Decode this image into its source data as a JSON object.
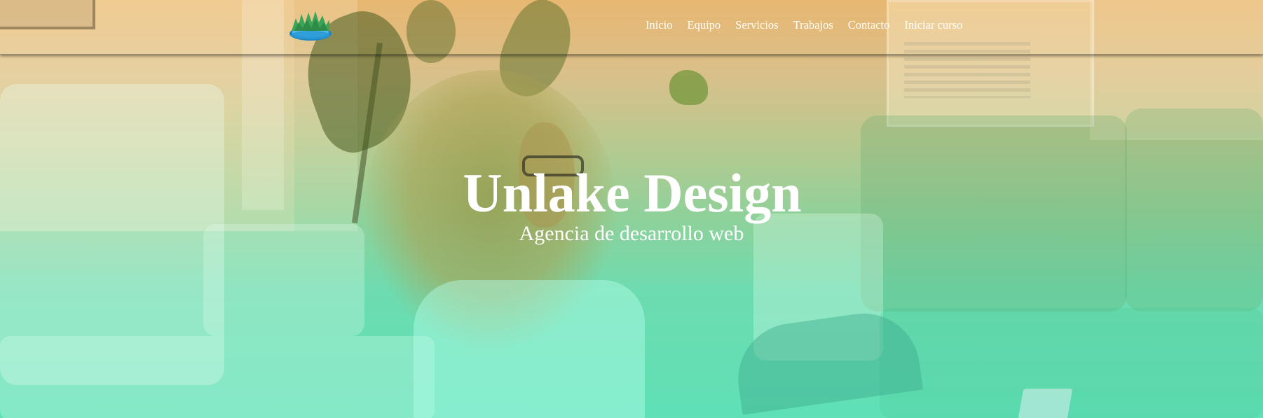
{
  "brand": {
    "logo_icon": "lake-island-logo-icon"
  },
  "nav": {
    "items": [
      {
        "label": "Inicio"
      },
      {
        "label": "Equipo"
      },
      {
        "label": "Servicios"
      },
      {
        "label": "Trabajos"
      },
      {
        "label": "Contacto"
      },
      {
        "label": "Iniciar curso"
      }
    ]
  },
  "hero": {
    "title": "Unlake Design",
    "subtitle": "Agencia de desarrollo web",
    "overlay_colors": [
      "#e8b772",
      "#8fd19a",
      "#5fe0b6"
    ]
  }
}
